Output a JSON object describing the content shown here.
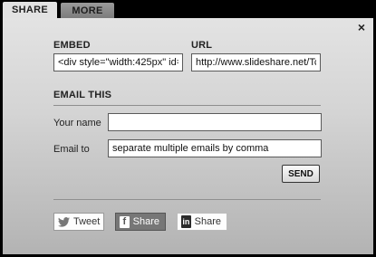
{
  "tabs": [
    {
      "label": "SHARE"
    },
    {
      "label": "MORE"
    }
  ],
  "close_glyph": "×",
  "embed": {
    "label": "EMBED",
    "value": "<div style=\"width:425px\" id="
  },
  "url": {
    "label": "URL",
    "value": "http://www.slideshare.net/Tc"
  },
  "email_section": {
    "heading": "EMAIL THIS",
    "name_label": "Your name",
    "name_value": "",
    "email_label": "Email to",
    "email_placeholder": "separate multiple emails by comma",
    "send_label": "SEND"
  },
  "social": {
    "tweet_label": "Tweet",
    "facebook_label": "Share",
    "facebook_glyph": "f",
    "linkedin_label": "Share",
    "linkedin_glyph": "in"
  }
}
